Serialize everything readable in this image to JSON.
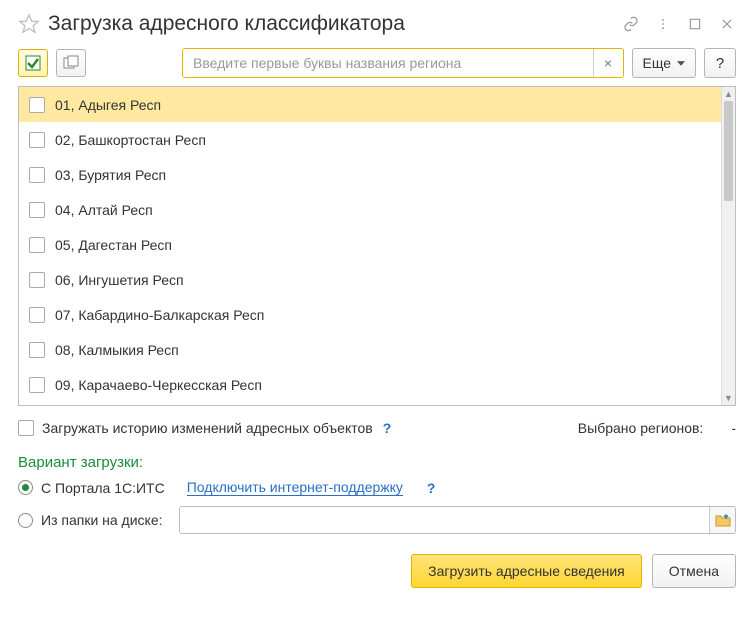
{
  "title": "Загрузка адресного классификатора",
  "toolbar": {
    "search_placeholder": "Введите первые буквы названия региона",
    "more_label": "Еще",
    "help_label": "?"
  },
  "regions": [
    {
      "label": "01, Адыгея Респ",
      "selected": true
    },
    {
      "label": "02, Башкортостан Респ",
      "selected": false
    },
    {
      "label": "03, Бурятия Респ",
      "selected": false
    },
    {
      "label": "04, Алтай Респ",
      "selected": false
    },
    {
      "label": "05, Дагестан Респ",
      "selected": false
    },
    {
      "label": "06, Ингушетия Респ",
      "selected": false
    },
    {
      "label": "07, Кабардино-Балкарская Респ",
      "selected": false
    },
    {
      "label": "08, Калмыкия Респ",
      "selected": false
    },
    {
      "label": "09, Карачаево-Черкесская Респ",
      "selected": false
    }
  ],
  "history": {
    "label": "Загружать историю изменений адресных объектов",
    "help": "?"
  },
  "selected_regions": {
    "label": "Выбрано регионов:",
    "value": "-"
  },
  "variant": {
    "title": "Вариант загрузки:",
    "portal_label": "С Портала 1С:ИТС",
    "portal_link": "Подключить интернет-поддержку",
    "portal_help": "?",
    "folder_label": "Из папки на диске:"
  },
  "footer": {
    "load_label": "Загрузить адресные сведения",
    "cancel_label": "Отмена"
  }
}
